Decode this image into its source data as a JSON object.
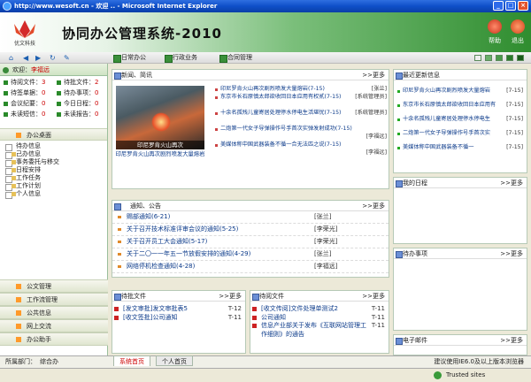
{
  "browser": {
    "title": "http://www.wesoft.cn - 欢迎 .. - Microsoft Internet Explorer",
    "buttons": [
      "_",
      "□",
      "×"
    ]
  },
  "header": {
    "title": "协同办公管理系统-2010",
    "logo_text": "优文科技",
    "help": "帮助",
    "exit": "退出"
  },
  "toolbar": {
    "items": [
      "日常办公",
      "行政业务",
      "合同管理"
    ]
  },
  "welcome": {
    "prefix": "欢迎：",
    "user": "李福远"
  },
  "stats": [
    {
      "label": "待阅文件：",
      "val": "3"
    },
    {
      "label": "待批文件：",
      "val": "2"
    },
    {
      "label": "待签单据：",
      "val": "0"
    },
    {
      "label": "待办事项：",
      "val": "0"
    },
    {
      "label": "会议纪要：",
      "val": "0"
    },
    {
      "label": "今日日程：",
      "val": "0"
    },
    {
      "label": "未读短信：",
      "val": "0"
    },
    {
      "label": "未读报告：",
      "val": "0"
    }
  ],
  "nav": {
    "desk": "办公桌面",
    "tree": [
      "待办信息",
      "己办信息",
      "事务委托与移交",
      "日程安排",
      "工作任务",
      "工作计划",
      "个人信息"
    ],
    "bottom": [
      "公文管理",
      "工作流管理",
      "公共信息",
      "网上交流",
      "办公助手"
    ]
  },
  "news": {
    "title": "新闻、简讯",
    "more": ">>更多",
    "photo_caption": "印尼罗肯火山再次剧烈喷发大量熔岩",
    "photo_overlay": "印尼罗肯火山再次",
    "items": [
      {
        "text": "印尼罗肯火山再次剧烈喷发大量熔岩(7-15)",
        "tag": "[张兰]"
      },
      {
        "text": "东京市长石原慎太郎欲收回日本应用有权贰(7-15)",
        "tag": "[系统管理员]"
      },
      {
        "text": "十余名孤残儿童寄居处理停水停电生活堪忧(7-15)",
        "tag": "[系统管理员]"
      },
      {
        "text": "二炮第一代女子导弹操作号手首次实弹发射成功(7-15)",
        "tag": "[李福远]"
      },
      {
        "text": "美媒体称中国武器装备不循一合无法匹之说(7-15)",
        "tag": "[李福远]"
      }
    ]
  },
  "notice": {
    "title": "通知、公告",
    "more": ">>更多",
    "items": [
      {
        "text": "赐部通知(6-21)",
        "author": "[张兰]"
      },
      {
        "text": "关于召开技术标准评审会议的通知(5-25)",
        "author": "[李荣光]"
      },
      {
        "text": "关于召开员工大会通知(5-17)",
        "author": "[李荣光]"
      },
      {
        "text": "关于二〇一一年五一节放假安排的通知(4-29)",
        "author": "[张兰]"
      },
      {
        "text": "网络停机检查通知(4-28)",
        "author": "[李福远]"
      }
    ]
  },
  "pending": {
    "title": "待批文件",
    "more": ">>更多",
    "items": [
      {
        "text": "[发文审批]发文审批表5",
        "date": "T-12"
      },
      {
        "text": "[收文签批]公司通知",
        "date": "T-11"
      }
    ]
  },
  "toread": {
    "title": "待阅文件",
    "more": ">>更多",
    "items": [
      {
        "text": "[收文传阅]文件处理单测试2",
        "date": "T-11"
      },
      {
        "text": "公司通知",
        "date": "T-11"
      },
      {
        "text": "信息产业部关于发布《互联网站管理工作细则》的通告",
        "date": "T-11"
      }
    ]
  },
  "latest": {
    "title": "最近更新信息",
    "items": [
      {
        "text": "印尼罗肯火山再次剧烈喷发大量熔岩",
        "date": "[7-15]"
      },
      {
        "text": "东京市长石原慎太郎欲收回日本应用有",
        "date": "[7-15]"
      },
      {
        "text": "十余名孤残儿童寄居处理停水停电生",
        "date": "[7-15]"
      },
      {
        "text": "二炮第一代女子导弹操作号手首次实",
        "date": "[7-15]"
      },
      {
        "text": "美媒体称中国武器装备不循一",
        "date": "[7-15]"
      }
    ]
  },
  "right_panels": {
    "schedule": "我的日程",
    "todo": "待办事项",
    "email": "电子邮件",
    "more": ">>更多"
  },
  "status": {
    "dept_label": "所属部门：",
    "dept": "综合办",
    "note": "建议使用IE6.0及以上版本浏览器"
  },
  "tabs": [
    "系统首页",
    "个人首页"
  ],
  "ie_status": {
    "zone": "Trusted sites"
  }
}
